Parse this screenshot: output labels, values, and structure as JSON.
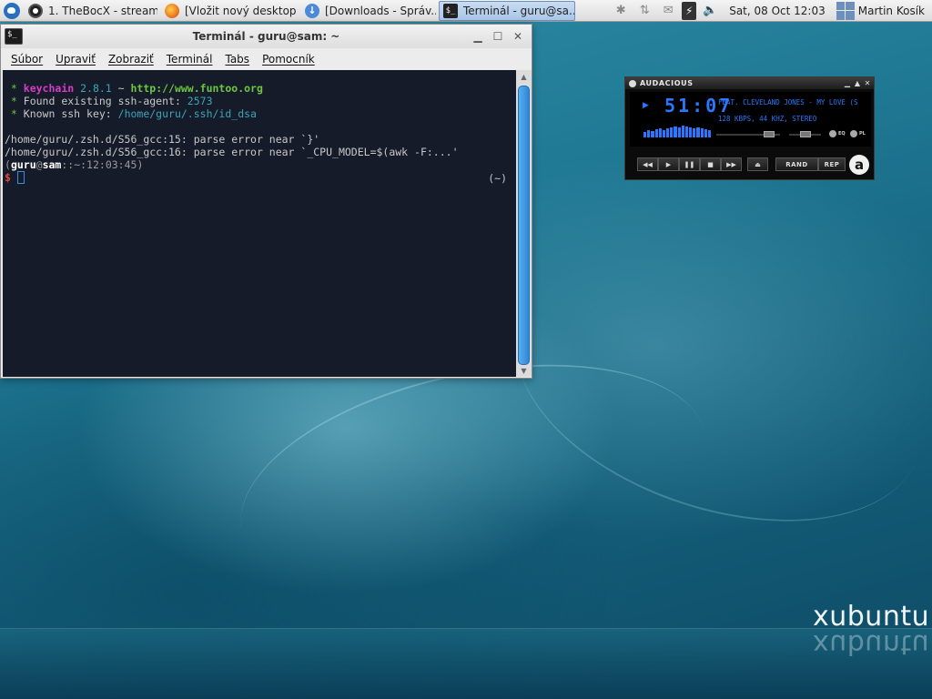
{
  "panel": {
    "tasks": [
      {
        "label": "1. TheBocX - stream...",
        "icon": "obs-icon"
      },
      {
        "label": "[Vložit nový desktop ...",
        "icon": "firefox-icon"
      },
      {
        "label": "[Downloads - Správ...",
        "icon": "download-icon"
      },
      {
        "label": "Terminál - guru@sa...",
        "icon": "terminal-icon"
      }
    ],
    "clock": "Sat, 08 Oct  12:03",
    "user": "Martin Kosík"
  },
  "terminal": {
    "title": "Terminál - guru@sam: ~",
    "menu": [
      "Súbor",
      "Upraviť",
      "Zobraziť",
      "Terminál",
      "Tabs",
      "Pomocník"
    ],
    "lines": {
      "l1_star": " * ",
      "l1_keychain": "keychain",
      "l1_version": " 2.8.1",
      "l1_tilde": " ~ ",
      "l1_url": "http://www.funtoo.org",
      "l2_star": " * ",
      "l2_text": "Found existing ssh-agent: ",
      "l2_pid": "2573",
      "l3_star": " * ",
      "l3_text": "Known ssh key: ",
      "l3_key": "/home/guru/.ssh/id_dsa",
      "err1": "/home/guru/.zsh.d/S56_gcc:15: parse error near `}'",
      "err2": "/home/guru/.zsh.d/S56_gcc:16: parse error near `_CPU_MODEL=$(awk -F:...'",
      "prompt_open": "(",
      "prompt_user": "guru",
      "prompt_at": "@",
      "prompt_host": "sam",
      "prompt_rest": "::~:12:03:45)",
      "prompt_dollar": "$ ",
      "rprompt": "(~)"
    }
  },
  "audacious": {
    "title": "AUDACIOUS",
    "time": "51:07",
    "song": "FEAT. CLEVELAND JONES - MY LOVE (S",
    "info": "128 KBPS, 44 KHZ, STEREO",
    "eq_label": "EQ",
    "pl_label": "PL",
    "rand_label": "RAND",
    "rep_label": "REP",
    "logo": "a"
  },
  "desktop": {
    "brand": "xubuntu"
  }
}
